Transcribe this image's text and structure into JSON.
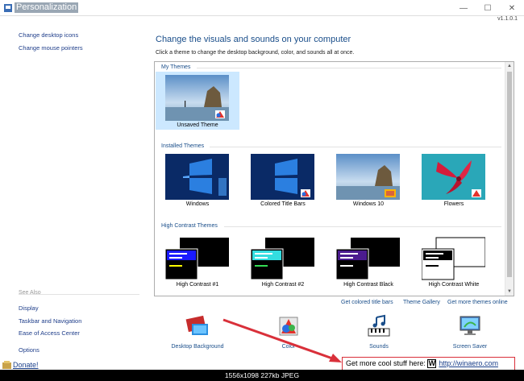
{
  "window": {
    "title": "Personalization",
    "version": "v1.1.0.1",
    "minimize": "—",
    "maximize": "☐",
    "close": "✕"
  },
  "left_links": [
    {
      "label": "Change desktop icons"
    },
    {
      "label": "Change mouse pointers"
    }
  ],
  "see_also": {
    "heading": "See Also",
    "items": [
      {
        "label": "Display"
      },
      {
        "label": "Taskbar and Navigation"
      },
      {
        "label": "Ease of Access Center"
      }
    ],
    "options_label": "Options"
  },
  "main": {
    "title": "Change the visuals and sounds on your computer",
    "subtitle": "Click a theme to change the desktop background, color, and sounds all at once."
  },
  "groups": {
    "my_themes": {
      "title": "My Themes",
      "items": [
        {
          "label": "Unsaved Theme"
        }
      ]
    },
    "installed": {
      "title": "Installed Themes",
      "items": [
        {
          "label": "Windows"
        },
        {
          "label": "Colored Title Bars"
        },
        {
          "label": "Windows 10"
        },
        {
          "label": "Flowers"
        }
      ]
    },
    "high_contrast": {
      "title": "High Contrast Themes",
      "items": [
        {
          "label": "High Contrast #1"
        },
        {
          "label": "High Contrast #2"
        },
        {
          "label": "High Contrast Black"
        },
        {
          "label": "High Contrast White"
        }
      ]
    }
  },
  "bottom_links": {
    "colored_title_bars": "Get colored title bars",
    "theme_gallery": "Theme Gallery",
    "more_themes": "Get more themes online"
  },
  "bottom_items": [
    {
      "label": "Desktop Background",
      "icon": "desktop-background-icon"
    },
    {
      "label": "Color",
      "icon": "color-icon"
    },
    {
      "label": "Sounds",
      "icon": "sounds-icon"
    },
    {
      "label": "Screen Saver",
      "icon": "screen-saver-icon"
    }
  ],
  "donate": "Donate!",
  "promo": {
    "text": "Get more cool stuff here:",
    "logo": "W",
    "url": "http://winaero.com"
  },
  "statusbar": "1556x1098  227kb  JPEG",
  "colors": {
    "accent": "#1a4e8a",
    "selection": "#cce8ff",
    "promo_border": "#d9303a"
  }
}
